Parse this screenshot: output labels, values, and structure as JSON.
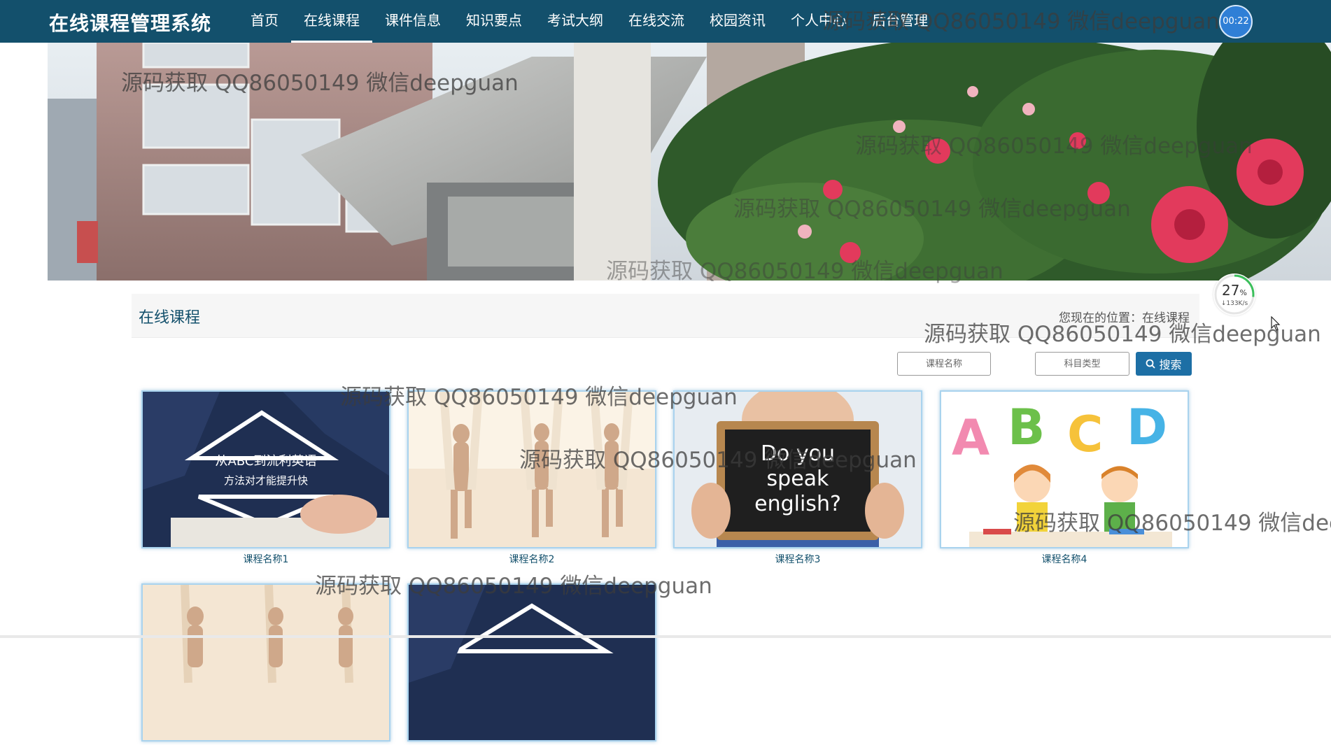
{
  "navbar": {
    "brand": "在线课程管理系统",
    "items": [
      {
        "label": "首页",
        "active": false
      },
      {
        "label": "在线课程",
        "active": true
      },
      {
        "label": "课件信息",
        "active": false
      },
      {
        "label": "知识要点",
        "active": false
      },
      {
        "label": "考试大纲",
        "active": false
      },
      {
        "label": "在线交流",
        "active": false
      },
      {
        "label": "校园资讯",
        "active": false
      },
      {
        "label": "个人中心",
        "active": false
      },
      {
        "label": "后台管理",
        "active": false
      }
    ],
    "timer": "00:22"
  },
  "section": {
    "title": "在线课程",
    "breadcrumb_prefix": "您现在的位置：",
    "breadcrumb_current": "在线课程"
  },
  "speed_widget": {
    "percent": "27",
    "percent_unit": "%",
    "rate": "↓133K/s",
    "progress": 0.27
  },
  "search": {
    "course_name_placeholder": "课程名称",
    "subject_type_placeholder": "科目类型",
    "button_label": "搜索",
    "button_icon": "search-icon"
  },
  "courses": [
    {
      "name": "课程名称1",
      "image_text": [
        "从ABC到流利英语",
        "方法对才能提升快"
      ]
    },
    {
      "name": "课程名称2",
      "image_text": []
    },
    {
      "name": "课程名称3",
      "image_text": [
        "Do you",
        "speak",
        "english?"
      ]
    },
    {
      "name": "课程名称4",
      "image_text": [
        "A",
        "B",
        "C",
        "D"
      ]
    },
    {
      "name": "",
      "image_text": []
    },
    {
      "name": "",
      "image_text": []
    }
  ],
  "watermark": "源码获取 QQ86050149 微信deepguan",
  "colors": {
    "navbar": "#13506c",
    "accent_button": "#1d6fa5",
    "title_text": "#13506c"
  }
}
